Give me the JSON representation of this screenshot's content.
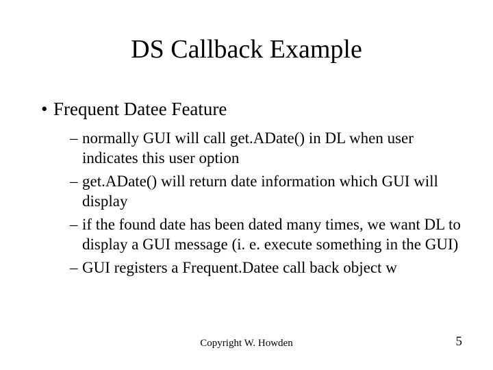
{
  "slide": {
    "title": "DS Callback Example",
    "topBullet": "Frequent Datee Feature",
    "subBullets": [
      "normally GUI will call get.ADate() in DL when user indicates this user option",
      "get.ADate() will return date information which GUI will display",
      "if the found date has been dated many times, we want DL to display a GUI message (i. e. execute something in the GUI)",
      "GUI registers a Frequent.Datee call back object w"
    ]
  },
  "footer": {
    "copyright": "Copyright W. Howden",
    "pageNumber": "5"
  }
}
